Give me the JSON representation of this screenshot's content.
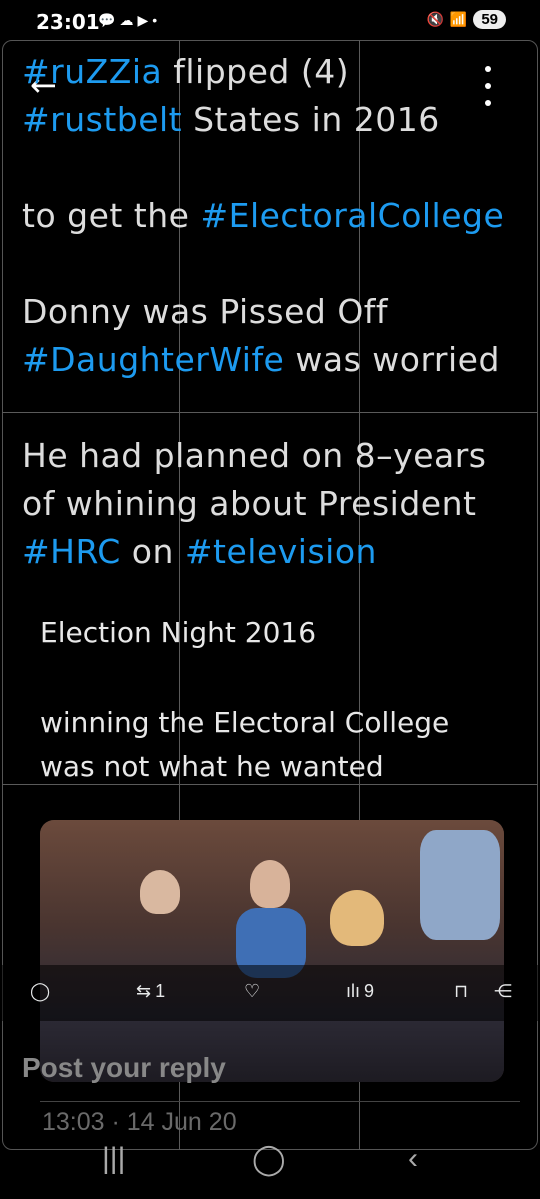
{
  "status": {
    "time": "23:01",
    "battery": "59"
  },
  "post": {
    "lines": [
      [
        {
          "t": "#ruZZia",
          "tag": true
        },
        {
          "t": " flipped (4)",
          "tag": false
        }
      ],
      [
        {
          "t": "#rustbelt",
          "tag": true
        },
        {
          "t": " States in 2016",
          "tag": false
        }
      ],
      [
        {
          "t": "to get the ",
          "tag": false
        },
        {
          "t": "#ElectoralCollege",
          "tag": true
        }
      ],
      [
        {
          "t": "Donny was Pissed Off",
          "tag": false
        }
      ],
      [
        {
          "t": "#DaughterWife",
          "tag": true
        },
        {
          "t": " was worried",
          "tag": false
        }
      ],
      [
        {
          "t": "He had planned on 8–years",
          "tag": false
        }
      ],
      [
        {
          "t": "of whining about President",
          "tag": false
        }
      ],
      [
        {
          "t": "#HRC",
          "tag": true
        },
        {
          "t": " on ",
          "tag": false
        },
        {
          "t": "#television",
          "tag": true
        }
      ]
    ],
    "quote": {
      "line1": "Election Night 2016",
      "line2": "winning the Electoral College",
      "line3": "was not what he wanted"
    }
  },
  "actions": {
    "retweets": "1",
    "views": "9"
  },
  "reply_placeholder": "Post your reply",
  "timestamp": "13:03 · 14 Jun 20"
}
